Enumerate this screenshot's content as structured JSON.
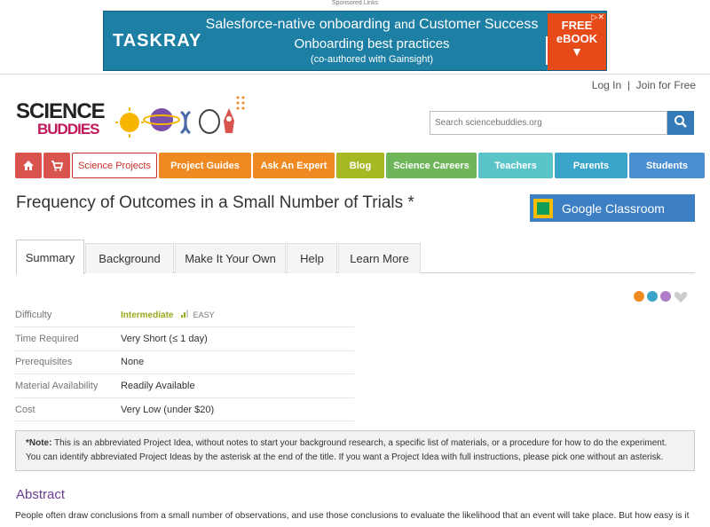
{
  "ad": {
    "sponsored_label": "Sponsored Links",
    "brand": "TASKRAY",
    "line1_main": "Salesforce-native onboarding",
    "line1_and": "and",
    "line1_end": "Customer Success",
    "line2": "Onboarding best practices",
    "line3": "(co-authored with Gainsight)",
    "cta_line1": "FREE",
    "cta_line2": "eBOOK",
    "colors": {
      "background": "#1d7fa3",
      "cta": "#e64a19"
    }
  },
  "header": {
    "login": "Log In",
    "separator": "|",
    "join": "Join for Free",
    "logo_top": "SCIENCE",
    "logo_bottom": "BUDDIES",
    "search_placeholder": "Search sciencebuddies.org"
  },
  "nav": {
    "items": [
      {
        "label": "",
        "icon": "home-icon",
        "color": "#d9534f"
      },
      {
        "label": "",
        "icon": "cart-icon",
        "color": "#d9534f"
      },
      {
        "label": "Science Projects",
        "color": "#ffffff"
      },
      {
        "label": "Project Guides",
        "color": "#ef8a22"
      },
      {
        "label": "Ask An Expert",
        "color": "#ef8a22"
      },
      {
        "label": "Blog",
        "color": "#a6b823"
      },
      {
        "label": "Science Careers",
        "color": "#6fb559"
      },
      {
        "label": "Teachers",
        "color": "#5bc4c9"
      },
      {
        "label": "Parents",
        "color": "#3aa4c9"
      },
      {
        "label": "Students",
        "color": "#4a8fd0"
      }
    ]
  },
  "page": {
    "title": "Frequency of Outcomes in a Small Number of Trials *",
    "google_classroom": "Google Classroom"
  },
  "tabs": [
    {
      "label": "Summary",
      "active": true
    },
    {
      "label": "Background",
      "active": false
    },
    {
      "label": "Make It Your Own",
      "active": false
    },
    {
      "label": "Help",
      "active": false
    },
    {
      "label": "Learn More",
      "active": false
    }
  ],
  "share_icons": [
    "wikiapp-icon",
    "print-icon",
    "email-icon",
    "favorite-heart-icon"
  ],
  "details": {
    "rows": [
      {
        "key": "Difficulty",
        "value": "Intermediate",
        "extra": "EASY"
      },
      {
        "key": "Time Required",
        "value": "Very Short (≤ 1 day)"
      },
      {
        "key": "Prerequisites",
        "value": "None"
      },
      {
        "key": "Material Availability",
        "value": "Readily Available"
      },
      {
        "key": "Cost",
        "value": "Very Low (under $20)"
      }
    ]
  },
  "note": {
    "label": "*Note:",
    "line1": "This is an abbreviated Project Idea, without notes to start your background research, a specific list of materials, or a procedure for how to do the experiment.",
    "line2": "You can identify abbreviated Project Ideas by the asterisk at the end of the title. If you want a Project Idea with full instructions, please pick one without an asterisk."
  },
  "abstract": {
    "heading": "Abstract",
    "text": "People often draw conclusions from a small number of observations, and use those conclusions to evaluate the likelihood that an event will take place. But how easy is it"
  }
}
